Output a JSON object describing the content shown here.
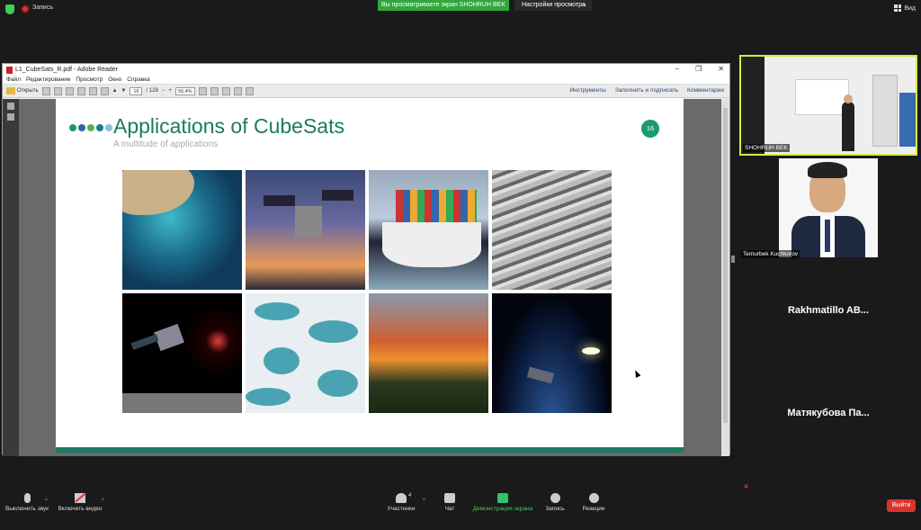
{
  "topbar": {
    "record_label": "Запись",
    "share_banner": "Вы просматриваете экран SHOHRUH BEK",
    "view_options": "Настройки просмотра",
    "view_button": "Вид"
  },
  "adobe": {
    "window_title": "L1_CubeSats_R.pdf - Adobe Reader",
    "menu": [
      "Файл",
      "Редактирование",
      "Просмотр",
      "Окно",
      "Справка"
    ],
    "open_label": "Открыть",
    "page_current": "16",
    "page_total": "/ 128",
    "zoom": "56,4%",
    "tools": "Инструменты",
    "fill_sign": "Заполнить и подписать",
    "comments": "Комментарии"
  },
  "slide": {
    "title": "Applications of CubeSats",
    "subtitle": "A multitude of applications",
    "page_number": "16",
    "dot_colors": [
      "#1c9a70",
      "#2a6aa0",
      "#5ab04a",
      "#1a7a9a",
      "#8ac0d0"
    ]
  },
  "participants": {
    "presenter_name": "SHOHRUH BEK",
    "p2_name": "Temurbek Kuchkorov",
    "p3_name": "Rakhmatillo AB...",
    "p4_name": "Матякубова Па..."
  },
  "bottombar": {
    "mute": "Выключить звук",
    "video": "Включить видео",
    "participants": "Участники",
    "participants_count": "4",
    "chat": "Чат",
    "share": "Демонстрация экрана",
    "record": "Запись",
    "reactions": "Реакции",
    "exit": "Выйти"
  }
}
